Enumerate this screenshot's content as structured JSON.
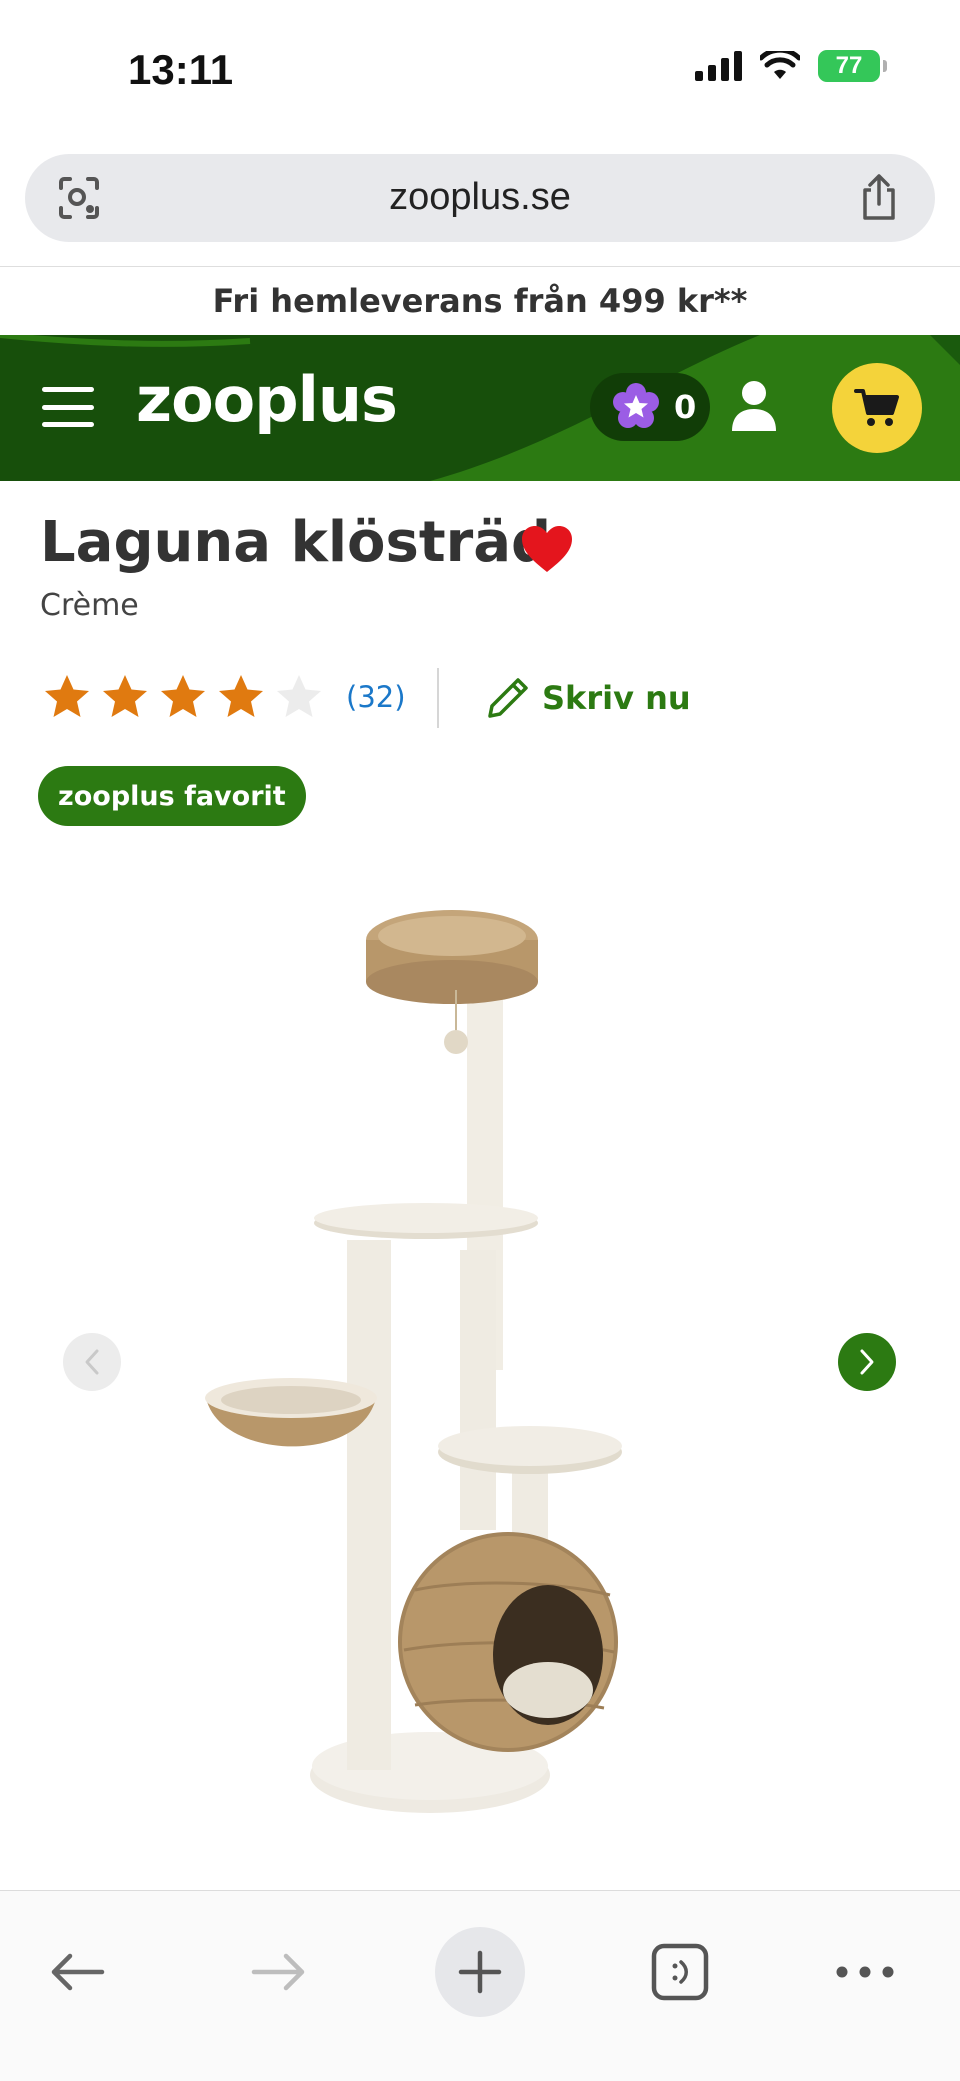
{
  "status_bar": {
    "time": "13:11",
    "battery": "77"
  },
  "browser": {
    "url": "zooplus.se"
  },
  "promo": {
    "text": "Fri hemleverans från 499 kr**"
  },
  "header": {
    "logo": "zooplus",
    "points_count": "0"
  },
  "product": {
    "title": "Laguna klösträd",
    "variant": "Crème",
    "rating_value": 4,
    "rating_max": 5,
    "review_count": "(32)",
    "write_review_label": "Skriv nu",
    "badge": "zooplus favorit"
  },
  "colors": {
    "brand_green": "#2c7a12",
    "header_dark_green": "#174f0b",
    "cart_yellow": "#f4d33a",
    "star_orange": "#e07a10",
    "heart_red": "#e4151d",
    "link_blue": "#1b78c9"
  },
  "icons": {
    "url_left": "visual-lookup-icon",
    "url_right": "share-icon",
    "menu": "hamburger-icon",
    "points": "star-flower-icon",
    "account": "user-icon",
    "cart": "cart-icon",
    "favorite": "heart-icon",
    "write": "pencil-icon",
    "gallery_prev": "chevron-left-icon",
    "gallery_next": "chevron-right-icon",
    "toolbar": [
      "back-arrow-icon",
      "forward-arrow-icon",
      "plus-icon",
      "tabs-icon",
      "more-icon"
    ]
  }
}
